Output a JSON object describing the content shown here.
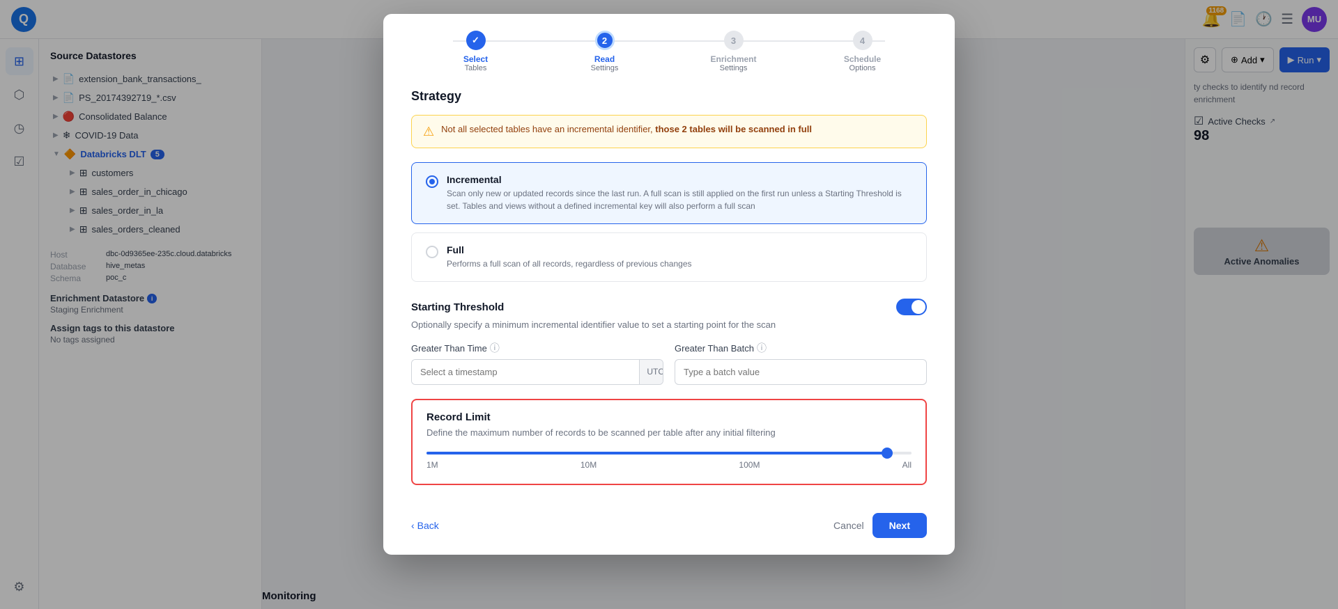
{
  "app": {
    "logo": "Q",
    "notification_count": "1168",
    "avatar_initials": "MU"
  },
  "sidebar": {
    "items": [
      {
        "icon": "⊞",
        "label": "grid-icon",
        "active": false
      },
      {
        "icon": "⬡",
        "label": "network-icon",
        "active": false
      },
      {
        "icon": "◷",
        "label": "clock-icon",
        "active": false
      },
      {
        "icon": "☑",
        "label": "check-icon",
        "active": false
      },
      {
        "icon": "⚙",
        "label": "settings-icon",
        "active": false
      }
    ]
  },
  "left_panel": {
    "title": "Source Datastores",
    "items": [
      {
        "label": "extension_bank_transactions_",
        "type": "file",
        "expanded": false
      },
      {
        "label": "PS_20174392719_*.csv",
        "type": "file",
        "expanded": false
      },
      {
        "label": "Consolidated Balance",
        "type": "pipeline",
        "expanded": false
      },
      {
        "label": "COVID-19 Data",
        "type": "snowflake",
        "expanded": false
      },
      {
        "label": "Databricks DLT",
        "type": "databricks",
        "active": true,
        "expanded": true,
        "badge": "5"
      },
      {
        "label": "customers",
        "type": "table",
        "child": true
      },
      {
        "label": "sales_order_in_chicago",
        "type": "table",
        "child": true
      },
      {
        "label": "sales_order_in_la",
        "type": "table",
        "child": true
      },
      {
        "label": "sales_orders_cleaned",
        "type": "table",
        "child": true
      }
    ],
    "datastore_detail": {
      "host_label": "Host",
      "host_value": "dbc-0d9365ee-235c.cloud.databricks",
      "db_label": "Database",
      "db_value": "hive_metas",
      "schema_label": "Schema",
      "schema_value": "poc_c"
    },
    "enrichment": {
      "title": "Enrichment Datastore",
      "value": "Staging Enrichment"
    },
    "tags": {
      "title": "Assign tags to this datastore",
      "value": "No tags assigned"
    }
  },
  "right_panel": {
    "settings_icon": "⚙",
    "add_label": "Add",
    "run_label": "Run",
    "description": "ty checks to identify nd record enrichment",
    "active_checks_label": "Active Checks",
    "checks_count": "98",
    "anomalies_title": "Active Anomalies"
  },
  "modal": {
    "steps": [
      {
        "label": "Select",
        "sublabel": "Tables",
        "state": "done",
        "circle": "✓"
      },
      {
        "label": "Read",
        "sublabel": "Settings",
        "state": "active",
        "circle": "2"
      },
      {
        "label": "Enrichment",
        "sublabel": "Settings",
        "state": "inactive",
        "circle": "3"
      },
      {
        "label": "Schedule",
        "sublabel": "Options",
        "state": "inactive",
        "circle": "4"
      }
    ],
    "strategy": {
      "title": "Strategy",
      "warning": {
        "text_normal": "Not all selected tables have an incremental identifier,",
        "text_bold": "those 2 tables will be scanned in full"
      },
      "options": [
        {
          "id": "incremental",
          "label": "Incremental",
          "description": "Scan only new or updated records since the last run. A full scan is still applied on the first run unless a Starting Threshold is set. Tables and views without a defined incremental key will also perform a full scan",
          "selected": true
        },
        {
          "id": "full",
          "label": "Full",
          "description": "Performs a full scan of all records, regardless of previous changes",
          "selected": false
        }
      ]
    },
    "threshold": {
      "title": "Starting Threshold",
      "description": "Optionally specify a minimum incremental identifier value to set a starting point for the scan",
      "enabled": true,
      "greater_than_time": {
        "label": "Greater Than Time",
        "placeholder": "Select a timestamp",
        "utc": "UTC"
      },
      "greater_than_batch": {
        "label": "Greater Than Batch",
        "placeholder": "Type a batch value"
      }
    },
    "record_limit": {
      "title": "Record Limit",
      "description": "Define the maximum number of records to be scanned per table after any initial filtering",
      "slider": {
        "labels": [
          "1M",
          "10M",
          "100M",
          "All"
        ],
        "position": 95
      }
    },
    "footer": {
      "back_label": "Back",
      "cancel_label": "Cancel",
      "next_label": "Next"
    }
  },
  "monitoring": {
    "title": "Monitoring"
  }
}
